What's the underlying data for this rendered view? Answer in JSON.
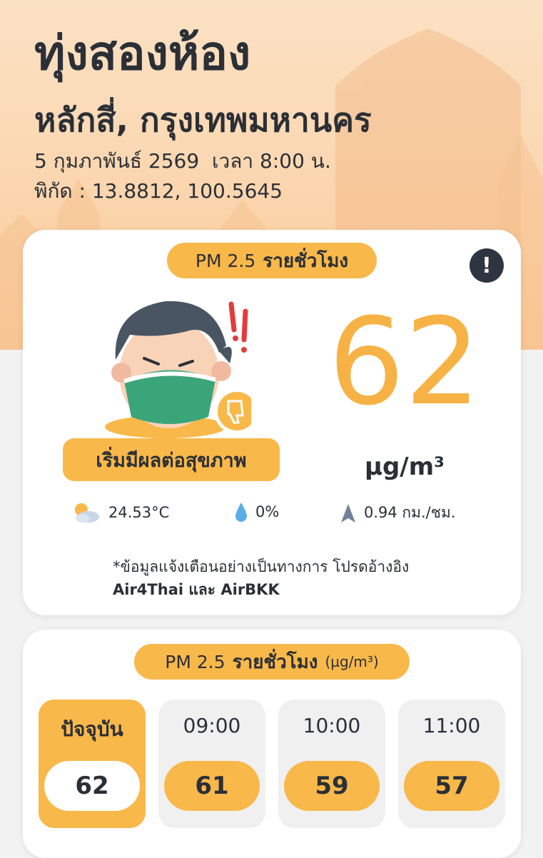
{
  "location": {
    "name": "ทุ่งสองห้อง",
    "district": "หลักสี่, กรุงเทพมหานคร",
    "datetime": "5 กุมภาพันธ์ 2569  เวลา 8:00 น.",
    "coordinates": "พิกัด : 13.8812, 100.5645"
  },
  "current_card": {
    "pill_label": "PM 2.5",
    "pill_bold": "รายชั่วโมง",
    "info_icon": "!",
    "status": "เริ่มมีผลต่อสุขภาพ",
    "value": "62",
    "unit": "µg/m³",
    "weather": {
      "temperature": "24.53°C",
      "rain": "0%",
      "wind": "0.94 กม./ชม."
    },
    "note_line1": "*ข้อมูลแจ้งเตือนอย่างเป็นทางการ โปรดอ้างอิง",
    "note_line2": "Air4Thai และ AirBKK"
  },
  "forecast_card": {
    "pill_label": "PM 2.5",
    "pill_bold": "รายชั่วโมง",
    "pill_unit": "(µg/m³)",
    "slots": [
      {
        "time": "ปัจจุบัน",
        "value": "62"
      },
      {
        "time": "09:00",
        "value": "61"
      },
      {
        "time": "10:00",
        "value": "59"
      },
      {
        "time": "11:00",
        "value": "57"
      }
    ]
  },
  "colors": {
    "accent": "#f8b84a",
    "value": "#f7b245",
    "text": "#2b2f36",
    "hero_bg": "#fbd8b3"
  }
}
